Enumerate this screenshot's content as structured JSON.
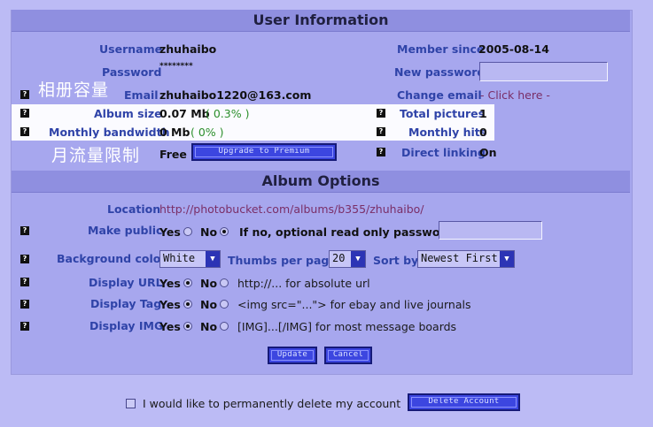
{
  "user_info": {
    "heading": "User Information",
    "username_label": "Username",
    "username": "zhuhaibo",
    "member_since_label": "Member since",
    "member_since": "2005-08-14",
    "password_label": "Password",
    "password_masked": "********",
    "new_password_label": "New password",
    "email_label": "Email",
    "email": "zhuhaibo1220@163.com",
    "change_email_label": "Change email",
    "change_email_link": "- Click here -",
    "album_size_label": "Album size",
    "album_size": "0.07 Mb",
    "album_size_pct": "( 0.3% )",
    "total_pictures_label": "Total pictures",
    "total_pictures": "1",
    "monthly_bandwidth_label": "Monthly bandwidth",
    "monthly_bandwidth": "0 Mb",
    "monthly_bandwidth_pct": "( 0% )",
    "monthly_hits_label": "Monthly hits",
    "monthly_hits": "0",
    "account_type": "Free",
    "upgrade_button": "Upgrade to Premium",
    "direct_linking_label": "Direct linking",
    "direct_linking": "On",
    "overlay_album_capacity": "相册容量",
    "overlay_monthly_traffic": "月流量限制"
  },
  "album_options": {
    "heading": "Album Options",
    "location_label": "Location",
    "location_url": "http://photobucket.com/albums/b355/zhuhaibo/",
    "make_public_label": "Make public",
    "yes": "Yes",
    "no": "No",
    "make_public_value": "No",
    "optional_password_label": "If no, optional read only password:",
    "background_color_label": "Background color",
    "background_color": "White",
    "thumbs_per_page_label": "Thumbs per page",
    "thumbs_per_page": "20",
    "sort_by_label": "Sort by",
    "sort_by": "Newest First",
    "display_url_label": "Display URL",
    "display_url_desc": "http://... for absolute url",
    "display_url_value": "Yes",
    "display_tag_label": "Display Tag",
    "display_tag_desc": "<img src=\"...\"> for ebay and live journals",
    "display_tag_value": "Yes",
    "display_img_label": "Display IMG",
    "display_img_desc": "[IMG]...[/IMG] for most message boards",
    "display_img_value": "Yes",
    "update_button": "Update",
    "cancel_button": "Cancel"
  },
  "delete": {
    "label": "I would like to permanently delete my account",
    "button": "Delete Account"
  },
  "help_icon_glyph": "?",
  "colors": {
    "background": "#bcbbf5",
    "header": "#8f8fe0",
    "label_blue": "#2f43a8",
    "button_blue": "#3c46e0",
    "green": "#2c8f2c",
    "link_purple": "#7a2e67"
  }
}
